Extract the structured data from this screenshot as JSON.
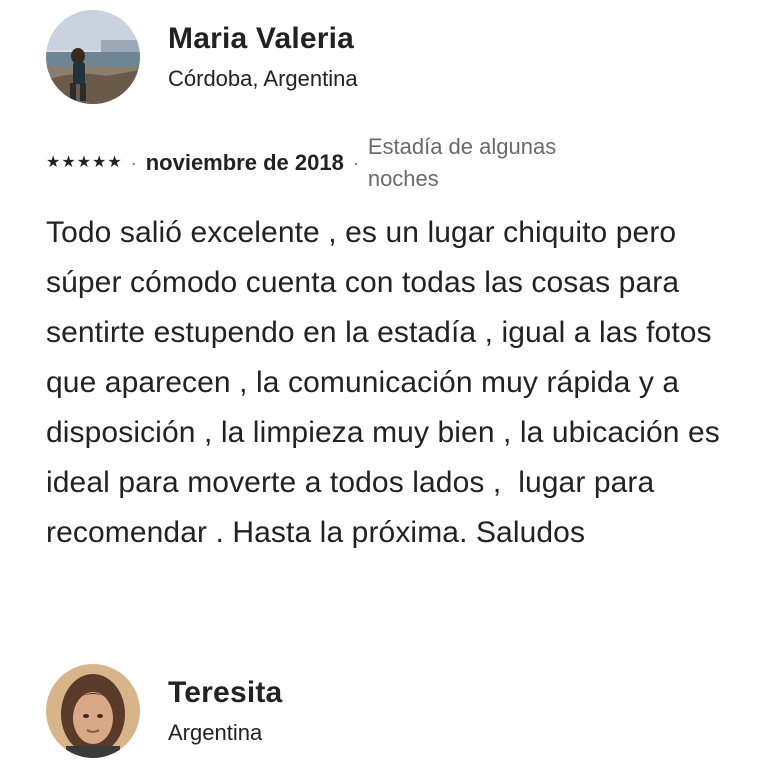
{
  "reviews": [
    {
      "name": "Maria Valeria",
      "location": "Córdoba, Argentina",
      "avatar": "reviewer-photo-beach",
      "rating_stars": 5,
      "star_glyph": "★",
      "separator": "·",
      "date": "noviembre de 2018",
      "stay_type": "Estadía de algunas noches",
      "text": "Todo salió excelente , es un lugar chiquito pero súper cómodo cuenta con todas las cosas para sentirte estupendo en la estadía , igual a las fotos que aparecen , la comunicación muy rápida y a disposición , la limpieza muy bien , la ubicación es ideal para moverte a todos lados ,  lugar para recomendar . Hasta la próxima. Saludos"
    },
    {
      "name": "Teresita",
      "location": "Argentina",
      "avatar": "reviewer-photo-portrait"
    }
  ]
}
